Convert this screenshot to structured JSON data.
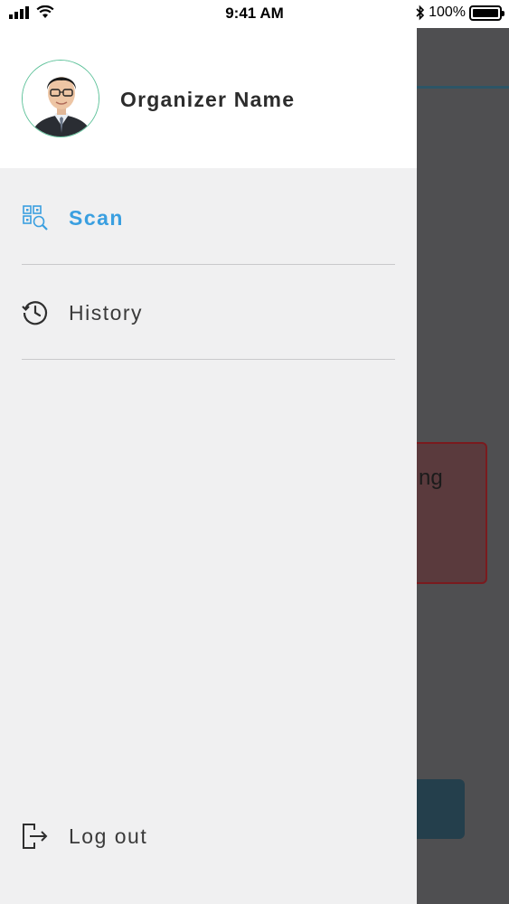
{
  "status_bar": {
    "time": "9:41 AM",
    "battery_text": "100%",
    "icons": [
      "signal-icon",
      "wifi-icon",
      "bluetooth-icon",
      "battery-icon"
    ]
  },
  "drawer": {
    "header": {
      "organizer_name": "Organizer Name"
    },
    "items": [
      {
        "label": "Scan",
        "icon": "qr-scan-icon",
        "active": true
      },
      {
        "label": "History",
        "icon": "history-icon",
        "active": false
      }
    ],
    "logout": {
      "label": "Log out",
      "icon": "logout-icon"
    }
  },
  "background": {
    "card_text_fragment": "ng"
  },
  "colors": {
    "accent": "#3a9fe0",
    "drawer_bg": "#f0f0f1",
    "overlay": "#4f4f51",
    "avatar_border": "#5ec29a"
  }
}
